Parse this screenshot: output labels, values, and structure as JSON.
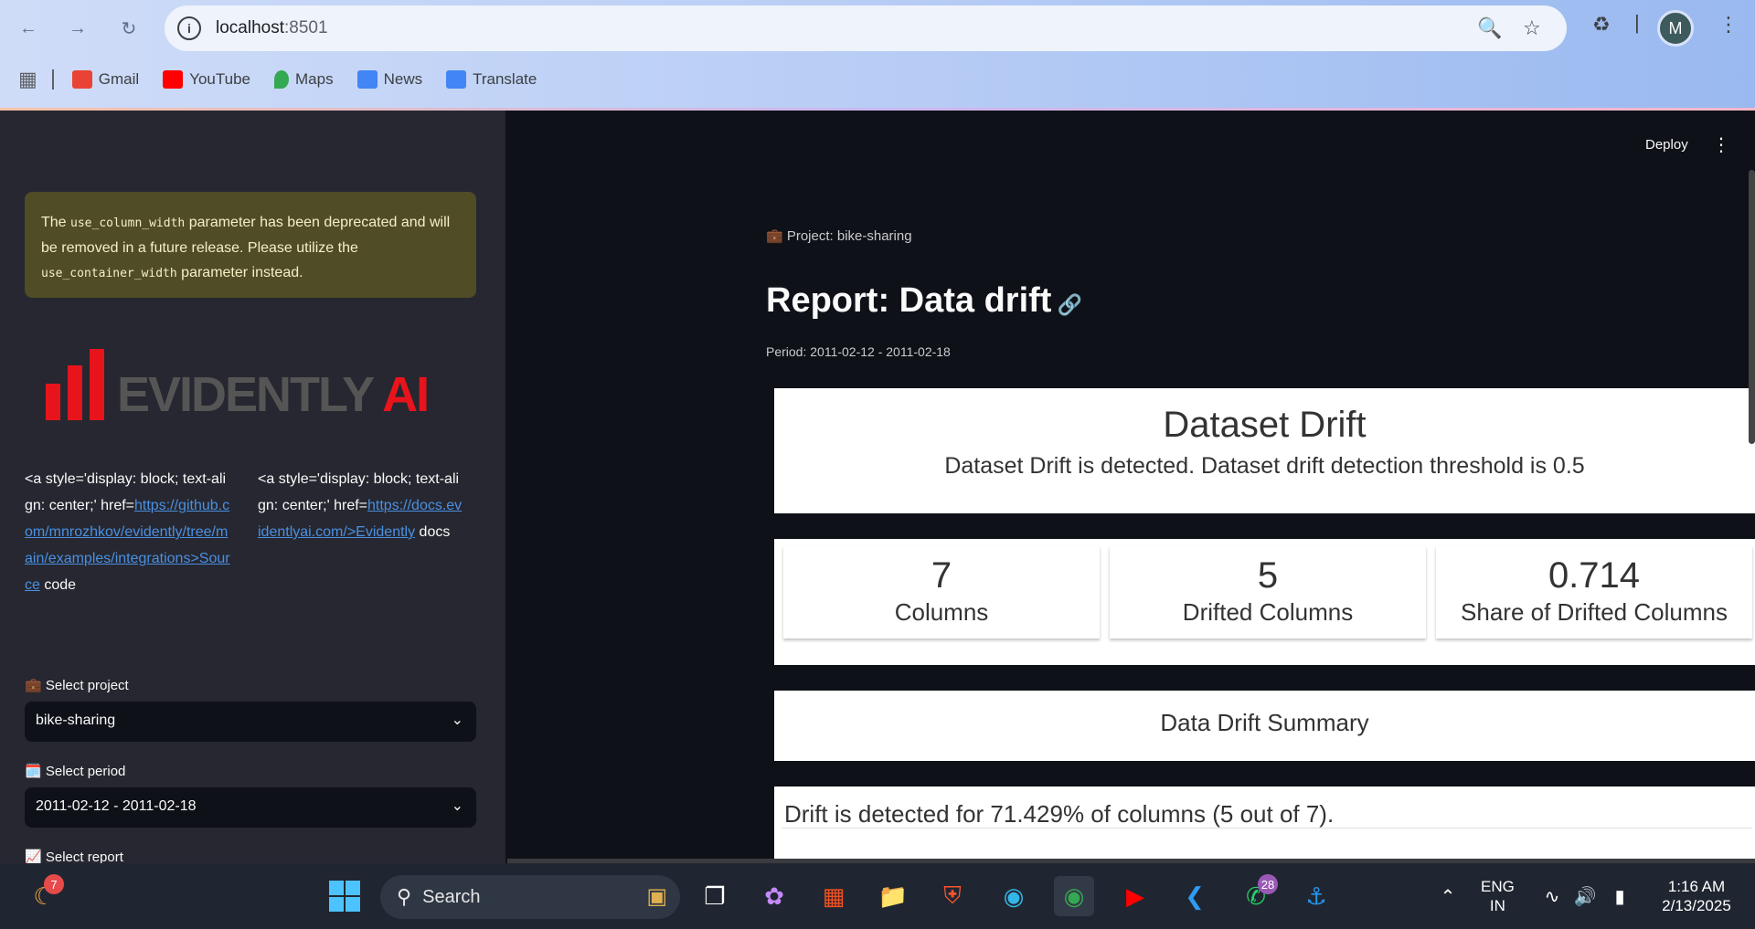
{
  "browser": {
    "url_host": "localhost",
    "url_port": ":8501",
    "avatar_letter": "M",
    "bookmarks": [
      {
        "label": "Gmail",
        "color": "#ea4335"
      },
      {
        "label": "YouTube",
        "color": "#ff0000"
      },
      {
        "label": "Maps",
        "color": "#34a853"
      },
      {
        "label": "News",
        "color": "#4285f4"
      },
      {
        "label": "Translate",
        "color": "#4285f4"
      }
    ]
  },
  "sidebar": {
    "warning": {
      "pre": "The ",
      "code1": "use_column_width",
      "mid": " parameter has been deprecated and will be removed in a future release. Please utilize the ",
      "code2": "use_container_width",
      "post": " parameter instead."
    },
    "logo": {
      "main": "EVIDENTLY",
      "accent": "AI"
    },
    "link_source": {
      "prefix": "<a style='display: block; text-align: center;' href=",
      "link": "https://github.com/mnrozhkov/evidently/tree/main/examples/integrations>Source",
      "suffix": " code"
    },
    "link_docs": {
      "prefix": "<a style='display: block; text-align: center;' href=",
      "link": "https://docs.evidentlyai.com/>Evidently",
      "suffix": " docs"
    },
    "select_project_label": "💼 Select project",
    "select_project_value": "bike-sharing",
    "select_period_label": "🗓️ Select period",
    "select_period_value": "2011-02-12 - 2011-02-18",
    "select_report_label": "📈 Select report"
  },
  "main": {
    "deploy_label": "Deploy",
    "project_line": "💼 Project: bike-sharing",
    "report_title": "Report: Data drift",
    "period": "Period: 2011-02-12 - 2011-02-18",
    "dataset_drift": {
      "title": "Dataset Drift",
      "subtitle": "Dataset Drift is detected. Dataset drift detection threshold is 0.5"
    },
    "metrics": [
      {
        "value": "7",
        "label": "Columns"
      },
      {
        "value": "5",
        "label": "Drifted Columns"
      },
      {
        "value": "0.714",
        "label": "Share of Drifted Columns"
      }
    ],
    "summary_title": "Data Drift Summary",
    "drift_text": "Drift is detected for 71.429% of columns (5 out of 7)."
  },
  "taskbar": {
    "search_label": "Search",
    "weather_badge": "7",
    "whatsapp_badge": "28",
    "lang_top": "ENG",
    "lang_bottom": "IN",
    "time": "1:16 AM",
    "date": "2/13/2025"
  }
}
